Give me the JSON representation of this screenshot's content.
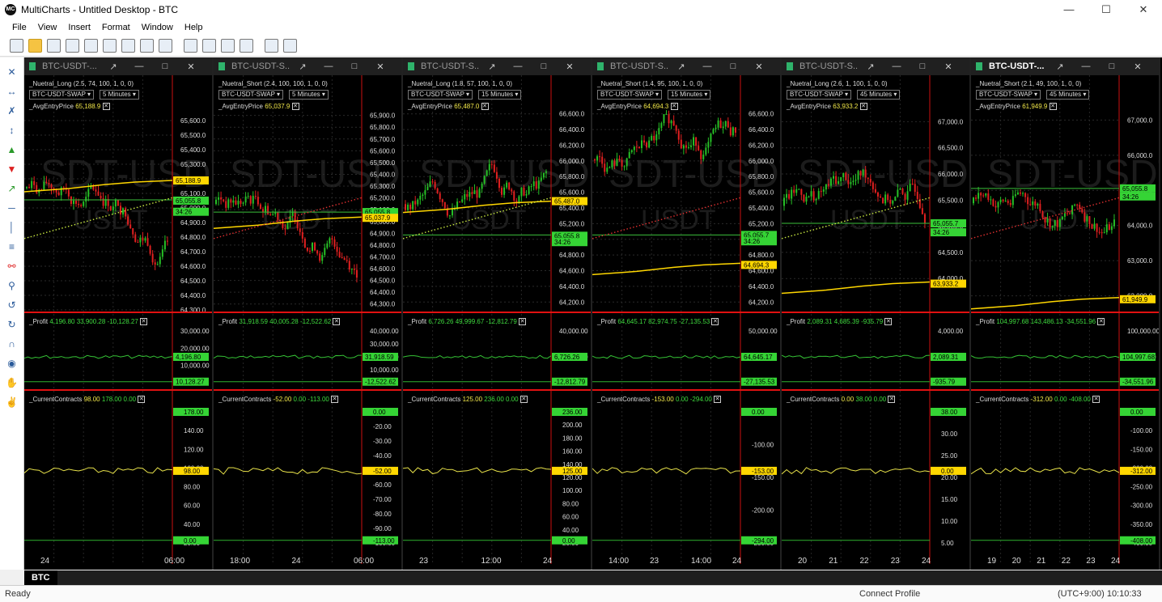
{
  "window": {
    "title": "MultiCharts - Untitled Desktop - BTC",
    "logo_text": "MC"
  },
  "menu": [
    "File",
    "View",
    "Insert",
    "Format",
    "Window",
    "Help"
  ],
  "tab_name": "BTC",
  "status": {
    "left": "Ready",
    "profile": "Connect Profile",
    "time": "(UTC+9:00) 10:10:33"
  },
  "watermark": {
    "line1": "SDT-USDT-",
    "line2": "USDT"
  },
  "colors": {
    "profit_line": "#35c335",
    "contracts_line": "#e8e24a",
    "avg_price": "#ffd700",
    "separator": "#e11111",
    "bull": "#26c026",
    "bear": "#e02020"
  },
  "panels": [
    {
      "title": "BTC-USDT-...",
      "active": false,
      "strategy": "_Nuetral_Long (2.5,  74,  100,  1,  0,  0)",
      "symbol": "BTC-USDT-SWAP",
      "timeframe": "5 Minutes",
      "avg_label": "_AvgEntryPrice",
      "avg_value": "65,188.9",
      "price_ticks": [
        "65,600.0",
        "65,500.0",
        "65,400.0",
        "65,300.0",
        "65,200.0",
        "65,100.0",
        "65,000.0",
        "64,900.0",
        "64,800.0",
        "64,700.0",
        "64,600.0",
        "64,500.0",
        "64,400.0",
        "64,300.0"
      ],
      "price_min": 64300,
      "price_max": 65700,
      "price_tags": [
        {
          "text": "65,188.9",
          "color": "#ffd700",
          "price": 65188.9
        },
        {
          "text": "65,055.8",
          "color": "#35d435",
          "price": 65055.8
        },
        {
          "text": "34:26",
          "color": "#35d435",
          "price": 64985
        }
      ],
      "profit_label": "_Profit",
      "profit_values": [
        "4,196.80",
        "33,900.28",
        "-10,128.27"
      ],
      "profit_ticks": [
        "30,000.00",
        "20,000.00",
        "10,000.00",
        "0.00"
      ],
      "profit_tags": [
        "33,900.28",
        "4,196.80",
        "10,128.27"
      ],
      "cc_label": "_CurrentContracts",
      "cc_values": [
        "98.00",
        "178.00",
        "0.00"
      ],
      "cc_ticks": [
        "160.00",
        "140.00",
        "120.00",
        "100.00",
        "80.00",
        "60.00",
        "40.00",
        "20.00"
      ],
      "cc_tags": [
        "178.00",
        "98.00",
        "0.00"
      ],
      "x_labels": [
        "24",
        "06:00"
      ]
    },
    {
      "title": "BTC-USDT-S...",
      "active": false,
      "strategy": "_Nuetral_Short (2.4,  100,  100,  1,  0,  0)",
      "symbol": "BTC-USDT-SWAP",
      "timeframe": "5 Minutes",
      "avg_label": "_AvgEntryPrice",
      "avg_value": "65,037.9",
      "price_ticks": [
        "65,900.0",
        "65,800.0",
        "65,700.0",
        "65,600.0",
        "65,500.0",
        "65,400.0",
        "65,300.0",
        "65,200.0",
        "65,100.0",
        "65,000.0",
        "64,900.0",
        "64,800.0",
        "64,700.0",
        "64,600.0",
        "64,500.0",
        "64,400.0",
        "64,300.0"
      ],
      "price_min": 64250,
      "price_max": 65980,
      "price_tags": [
        {
          "text": "65,055.8",
          "color": "#35d435",
          "price": 65080
        },
        {
          "text": "65,037.9",
          "color": "#ffd700",
          "price": 65037.9
        }
      ],
      "profit_label": "_Profit",
      "profit_values": [
        "31,918.59",
        "40,005.28",
        "-12,522.62"
      ],
      "profit_ticks": [
        "40,000.00",
        "30,000.00",
        "20,000.00",
        "10,000.00",
        "0.00"
      ],
      "profit_tags": [
        "40,005.28",
        "31,918.59",
        "-12,522.62"
      ],
      "cc_label": "_CurrentContracts",
      "cc_values": [
        "-52.00",
        "0.00",
        "-113.00"
      ],
      "cc_ticks": [
        "-10.00",
        "-20.00",
        "-30.00",
        "-40.00",
        "-50.00",
        "-60.00",
        "-70.00",
        "-80.00",
        "-90.00",
        "-100.00"
      ],
      "cc_tags": [
        "0.00",
        "-52.00",
        "-113.00"
      ],
      "x_labels": [
        "18:00",
        "24",
        "06:00"
      ]
    },
    {
      "title": "BTC-USDT-S...",
      "active": false,
      "strategy": "_Nuetral_Long (1.8,  57,  100,  1,  0,  0)",
      "symbol": "BTC-USDT-SWAP",
      "timeframe": "15 Minutes",
      "avg_label": "_AvgEntryPrice",
      "avg_value": "65,487.0",
      "price_ticks": [
        "66,600.0",
        "66,400.0",
        "66,200.0",
        "66,000.0",
        "65,800.0",
        "65,600.0",
        "65,400.0",
        "65,200.0",
        "65,000.0",
        "64,800.0",
        "64,600.0",
        "64,400.0",
        "64,200.0"
      ],
      "price_min": 64100,
      "price_max": 66700,
      "price_tags": [
        {
          "text": "65,487.0",
          "color": "#ffd700",
          "price": 65487
        },
        {
          "text": "65,055.8",
          "color": "#35d435",
          "price": 65055.8
        },
        {
          "text": "34:26",
          "color": "#35d435",
          "price": 64985
        }
      ],
      "profit_label": "_Profit",
      "profit_values": [
        "6,726.26",
        "49,999.67",
        "-12,812.79"
      ],
      "profit_ticks": [
        "40,000.00",
        "20,000.00",
        "0.00"
      ],
      "profit_tags": [
        "49,999.67",
        "6,726.26",
        "-12,812.79"
      ],
      "cc_label": "_CurrentContracts",
      "cc_values": [
        "125.00",
        "236.00",
        "0.00"
      ],
      "cc_ticks": [
        "220.00",
        "200.00",
        "180.00",
        "160.00",
        "140.00",
        "120.00",
        "100.00",
        "80.00",
        "60.00",
        "40.00",
        "20.00"
      ],
      "cc_tags": [
        "236.00",
        "125.00",
        "0.00"
      ],
      "x_labels": [
        "23",
        "12:00",
        "24"
      ]
    },
    {
      "title": "BTC-USDT-S...",
      "active": false,
      "strategy": "_Nuetral_Short (1.4,  95,  100,  1,  0,  0)",
      "symbol": "BTC-USDT-SWAP",
      "timeframe": "15 Minutes",
      "avg_label": "_AvgEntryPrice",
      "avg_value": "64,694.3",
      "price_ticks": [
        "66,600.0",
        "66,400.0",
        "66,200.0",
        "66,000.0",
        "65,800.0",
        "65,600.0",
        "65,400.0",
        "65,200.0",
        "65,000.0",
        "64,800.0",
        "64,600.0",
        "64,400.0",
        "64,200.0"
      ],
      "price_min": 64100,
      "price_max": 66700,
      "price_tags": [
        {
          "text": "65,055.7",
          "color": "#35d435",
          "price": 65055.7
        },
        {
          "text": "34:26",
          "color": "#35d435",
          "price": 64985
        },
        {
          "text": "64,694.3",
          "color": "#ffd700",
          "price": 64694.3
        }
      ],
      "profit_label": "_Profit",
      "profit_values": [
        "64,645.17",
        "82,974.75",
        "-27,135.53"
      ],
      "profit_ticks": [
        "50,000.00",
        "0.00"
      ],
      "profit_tags": [
        "82,974.75",
        "64,645.17",
        "-27,135.53"
      ],
      "cc_label": "_CurrentContracts",
      "cc_values": [
        "-153.00",
        "0.00",
        "-294.00"
      ],
      "cc_ticks": [
        "-50.00",
        "-100.00",
        "-150.00",
        "-200.00",
        "-250.00"
      ],
      "cc_tags": [
        "0.00",
        "-153.00",
        "-294.00"
      ],
      "x_labels": [
        "14:00",
        "23",
        "14:00",
        "24"
      ]
    },
    {
      "title": "BTC-USDT-S...",
      "active": false,
      "strategy": "_Nuetral_Long (2.6,  1,  100,  1,  0,  0)",
      "symbol": "BTC-USDT-SWAP",
      "timeframe": "45 Minutes",
      "avg_label": "_AvgEntryPrice",
      "avg_value": "63,933.2",
      "price_ticks": [
        "67,000.0",
        "66,500.0",
        "66,000.0",
        "65,500.0",
        "65,000.0",
        "64,500.0",
        "64,000.0"
      ],
      "price_min": 63400,
      "price_max": 67300,
      "price_tags": [
        {
          "text": "65,055.7",
          "color": "#35d435",
          "price": 65055.7
        },
        {
          "text": "34:26",
          "color": "#35d435",
          "price": 64900
        },
        {
          "text": "63,933.2",
          "color": "#ffd700",
          "price": 63933.2
        }
      ],
      "profit_label": "_Profit",
      "profit_values": [
        "2,089.31",
        "4,685.39",
        "-935.79"
      ],
      "profit_ticks": [
        "4,000.00",
        "2,000.00",
        "0.00"
      ],
      "profit_tags": [
        "4,685.39",
        "2,089.31",
        "-935.79"
      ],
      "cc_label": "_CurrentContracts",
      "cc_values": [
        "0.00",
        "38.00",
        "0.00"
      ],
      "cc_ticks": [
        "35.00",
        "30.00",
        "25.00",
        "20.00",
        "15.00",
        "10.00",
        "5.00"
      ],
      "cc_tags": [
        "38.00",
        "0.00"
      ],
      "x_labels": [
        "20",
        "21",
        "22",
        "23",
        "24"
      ]
    },
    {
      "title": "BTC-USDT-...",
      "active": true,
      "strategy": "_Nuetral_Short (2.1,  49,  100,  1,  0,  0)",
      "symbol": "BTC-USDT-SWAP",
      "timeframe": "45 Minutes",
      "avg_label": "_AvgEntryPrice",
      "avg_value": "61,949.9",
      "price_ticks": [
        "67,000.0",
        "66,000.0",
        "65,000.0",
        "64,000.0",
        "63,000.0",
        "62,000.0"
      ],
      "price_min": 61600,
      "price_max": 67400,
      "price_tags": [
        {
          "text": "65,055.8",
          "color": "#35d435",
          "price": 65055.8
        },
        {
          "text": "34:26",
          "color": "#35d435",
          "price": 64850
        },
        {
          "text": "61,949.9",
          "color": "#ffd700",
          "price": 61949.9
        }
      ],
      "profit_label": "_Profit",
      "profit_values": [
        "104,997.68",
        "143,486.13",
        "-34,551.96"
      ],
      "profit_ticks": [
        "100,000.00",
        "50,000.00",
        "0.00"
      ],
      "profit_tags": [
        "143,486.13",
        "104,997.68",
        "-34,551.96"
      ],
      "cc_label": "_CurrentContracts",
      "cc_values": [
        "-312.00",
        "0.00",
        "-408.00"
      ],
      "cc_ticks": [
        "-50.00",
        "-100.00",
        "-150.00",
        "-200.00",
        "-250.00",
        "-300.00",
        "-350.00",
        "-400.00"
      ],
      "cc_tags": [
        "0.00",
        "-312.00",
        "-408.00"
      ],
      "x_labels": [
        "19",
        "20",
        "21",
        "22",
        "23",
        "24"
      ]
    }
  ]
}
